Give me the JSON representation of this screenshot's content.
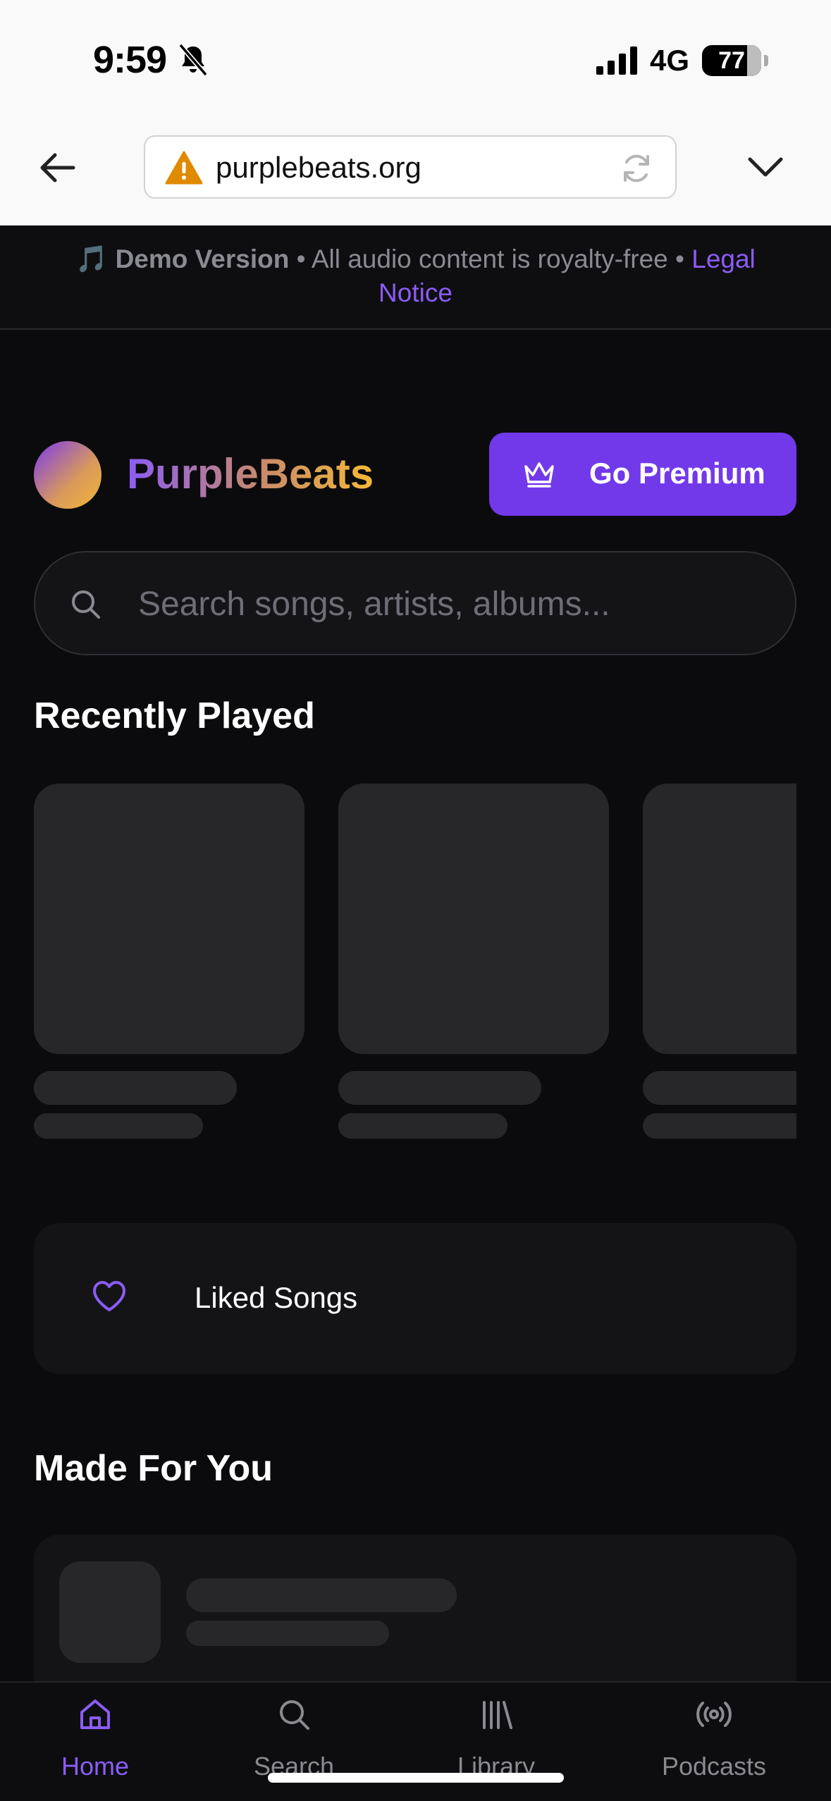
{
  "status_bar": {
    "time": "9:59",
    "network": "4G",
    "battery": "77"
  },
  "browser": {
    "url": "purplebeats.org"
  },
  "notice": {
    "emoji": "🎵",
    "bold": "Demo Version",
    "text": " • All audio content is royalty-free • ",
    "link": "Legal Notice"
  },
  "header": {
    "brand": "PurpleBeats",
    "premium_label": "Go Premium"
  },
  "search": {
    "placeholder": "Search songs, artists, albums..."
  },
  "sections": {
    "recently_played": "Recently Played",
    "made_for_you": "Made For You"
  },
  "liked": {
    "label": "Liked Songs"
  },
  "nav": {
    "home": "Home",
    "search": "Search",
    "library": "Library",
    "podcasts": "Podcasts"
  },
  "colors": {
    "accent": "#7239ea",
    "accent_text": "#8b5cf6",
    "background": "#0b0b0d",
    "skeleton": "#27272a"
  }
}
